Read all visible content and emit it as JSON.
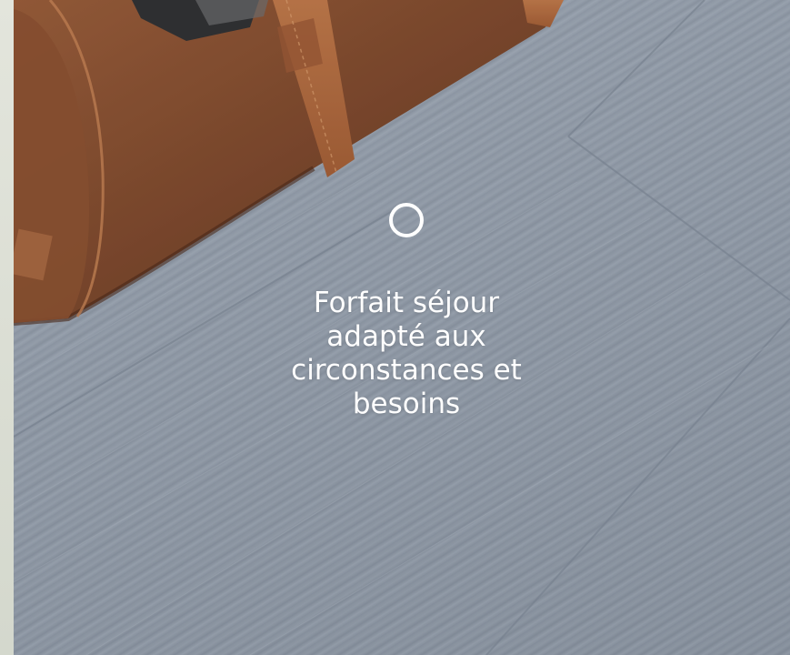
{
  "feature": {
    "icon": "circle-outline-icon",
    "text": "Forfait séjour adapté aux circonstances et besoins"
  },
  "colors": {
    "text": "#ffffff",
    "floor": "#98a2ae",
    "bag_leather": "#8a4f2c",
    "bag_strap": "#b5683a"
  }
}
